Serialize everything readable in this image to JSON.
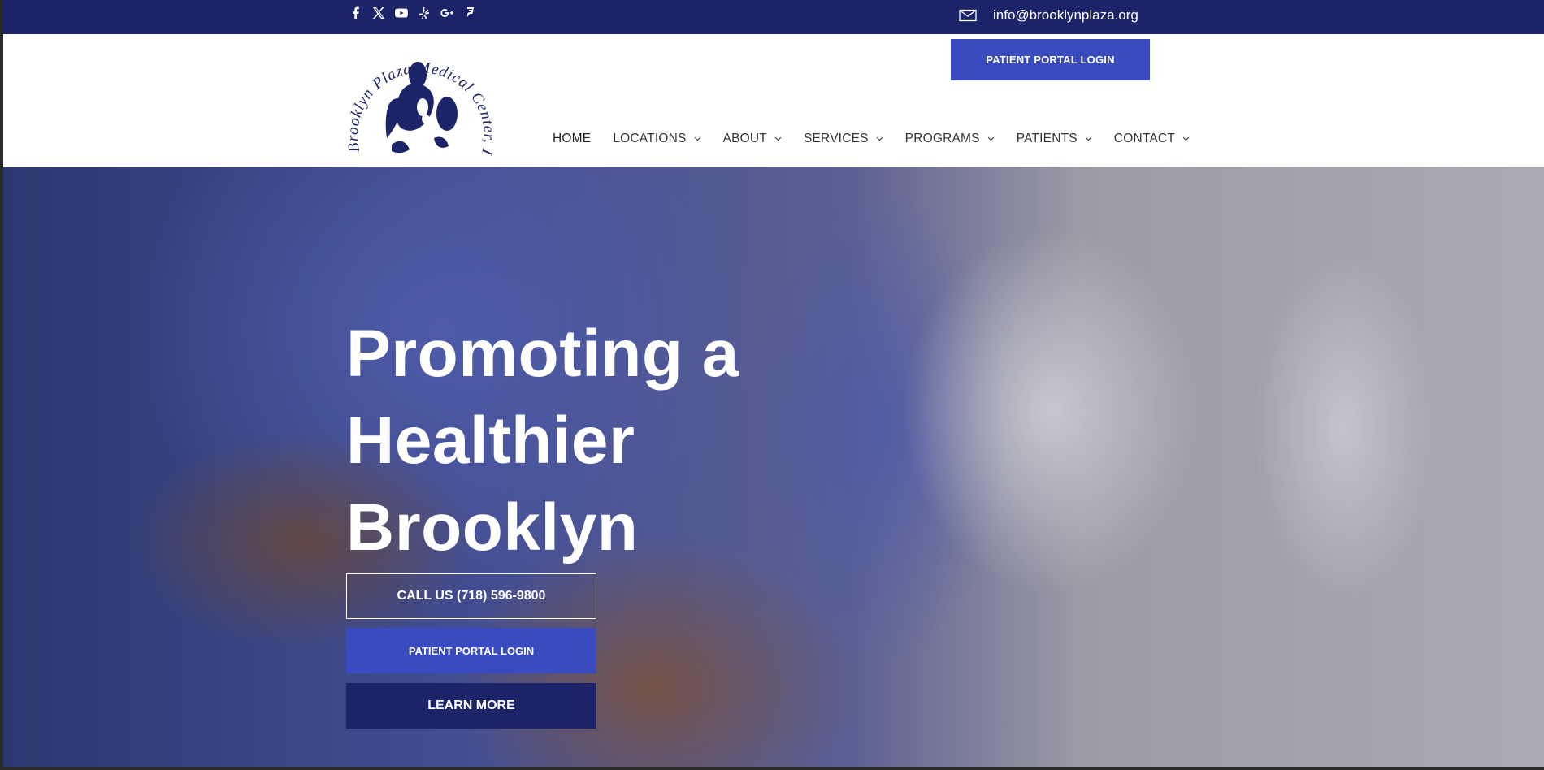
{
  "topbar": {
    "social_icons": [
      "facebook-icon",
      "x-twitter-icon",
      "youtube-icon",
      "yelp-icon",
      "google-plus-icon",
      "foursquare-icon"
    ],
    "email": "info@brooklynplaza.org",
    "background": "#1b2369"
  },
  "header": {
    "logo_text": "Brooklyn Plaza Medical Center, Inc",
    "portal_button": "PATIENT PORTAL LOGIN",
    "nav": [
      {
        "label": "HOME",
        "has_dropdown": false
      },
      {
        "label": "LOCATIONS",
        "has_dropdown": true
      },
      {
        "label": "ABOUT",
        "has_dropdown": true
      },
      {
        "label": "SERVICES",
        "has_dropdown": true
      },
      {
        "label": "PROGRAMS",
        "has_dropdown": true
      },
      {
        "label": "PATIENTS",
        "has_dropdown": true
      },
      {
        "label": "CONTACT",
        "has_dropdown": true
      }
    ]
  },
  "hero": {
    "headline_lines": [
      "Promoting a",
      "Healthier",
      "Brooklyn"
    ],
    "call_button": "CALL US (718) 596-9800",
    "portal_button": "PATIENT PORTAL LOGIN",
    "learn_button": "LEARN MORE"
  },
  "colors": {
    "navy": "#1b2369",
    "accent_blue": "#3a4bbf"
  }
}
